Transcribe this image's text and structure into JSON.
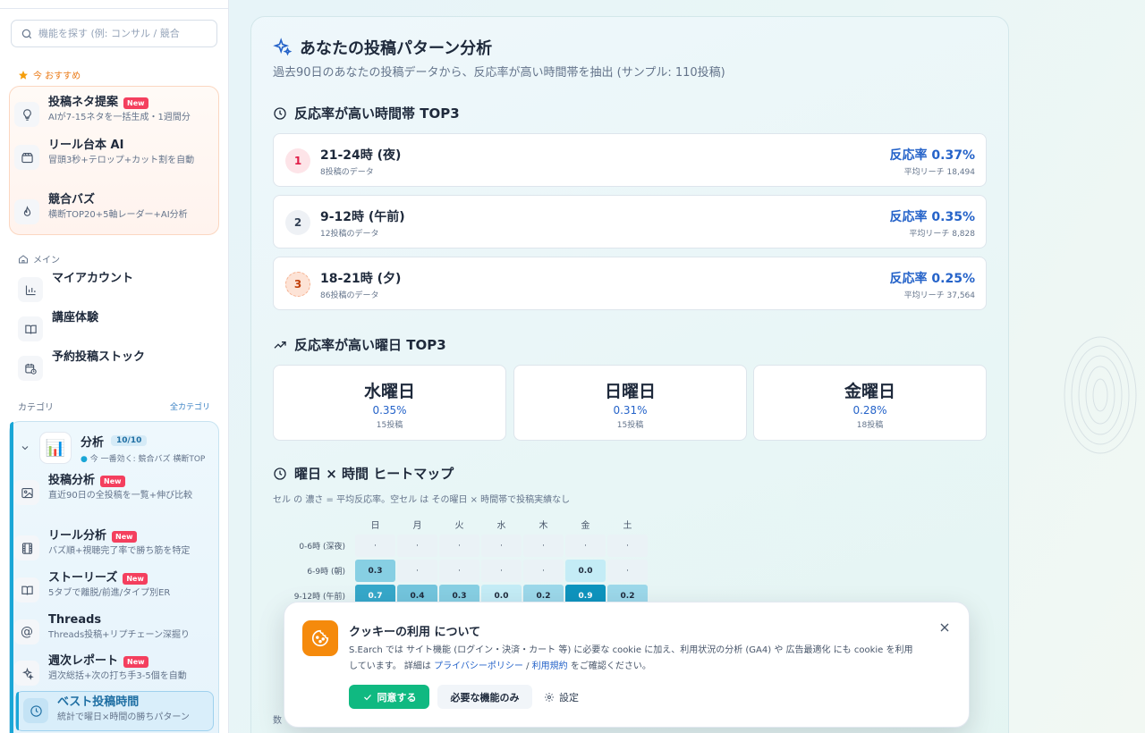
{
  "sidebar": {
    "search_placeholder": "機能を探す (例: コンサル / 競合",
    "recommended_label": "今 おすすめ",
    "recommended": [
      {
        "title": "投稿ネタ提案",
        "badge": "New",
        "sub": "AIが7-15ネタを一括生成・1週間分"
      },
      {
        "title": "リール台本 AI",
        "badge": "",
        "sub": "冒頭3秒+テロップ+カット割を自動"
      },
      {
        "title": "競合バズ",
        "badge": "",
        "sub": "横断TOP20+5軸レーダー+AI分析"
      }
    ],
    "main_label": "メイン",
    "main_items": [
      {
        "title": "マイアカウント"
      },
      {
        "title": "講座体験"
      },
      {
        "title": "予約投稿ストック"
      }
    ],
    "category_label": "カテゴリ",
    "all_categories": "全カテゴリ",
    "category": {
      "title": "分析",
      "count": "10/10",
      "sub": "今 一番効く: 競合バズ 横断TOP",
      "emoji": "📊",
      "items": [
        {
          "title": "投稿分析",
          "badge": "New",
          "sub": "直近90日の全投稿を一覧+伸び比較"
        },
        {
          "title": "リール分析",
          "badge": "New",
          "sub": "バズ順+視聴完了率で勝ち筋を特定"
        },
        {
          "title": "ストーリーズ",
          "badge": "New",
          "sub": "5タブで離脱/前進/タイプ別ER"
        },
        {
          "title": "Threads",
          "badge": "",
          "sub": "Threads投稿+リプチェーン深掘り"
        },
        {
          "title": "週次レポート",
          "badge": "New",
          "sub": "週次総括+次の打ち手3-5個を自動"
        },
        {
          "title": "ベスト投稿時間",
          "badge": "",
          "sub": "統計で曜日×時間の勝ちパターン"
        }
      ]
    }
  },
  "main": {
    "title": "あなたの投稿パターン分析",
    "subtitle": "過去90日のあなたの投稿データから、反応率が高い時間帯を抽出 (サンプル: 110投稿)",
    "time_section_title": "反応率が高い時間帯 TOP3",
    "time_top": [
      {
        "rank": "1",
        "time": "21-24時 (夜)",
        "count": "8投稿のデータ",
        "rate": "反応率 0.37%",
        "reach": "平均リーチ 18,494"
      },
      {
        "rank": "2",
        "time": "9-12時 (午前)",
        "count": "12投稿のデータ",
        "rate": "反応率 0.35%",
        "reach": "平均リーチ 8,828"
      },
      {
        "rank": "3",
        "time": "18-21時 (夕)",
        "count": "86投稿のデータ",
        "rate": "反応率 0.25%",
        "reach": "平均リーチ 37,564"
      }
    ],
    "day_section_title": "反応率が高い曜日 TOP3",
    "day_top": [
      {
        "day": "水曜日",
        "rate": "0.35%",
        "count": "15投稿"
      },
      {
        "day": "日曜日",
        "rate": "0.31%",
        "count": "15投稿"
      },
      {
        "day": "金曜日",
        "rate": "0.28%",
        "count": "18投稿"
      }
    ],
    "heatmap_title": "曜日 × 時間 ヒートマップ",
    "heatmap_note": "セル の 濃さ = 平均反応率。空セル は その曜日 × 時間帯で投稿実績なし",
    "heatmap": {
      "days": [
        "日",
        "月",
        "火",
        "水",
        "木",
        "金",
        "土"
      ],
      "rows": [
        {
          "label": "0-6時 (深夜)",
          "values": [
            null,
            null,
            null,
            null,
            null,
            null,
            null
          ]
        },
        {
          "label": "6-9時 (朝)",
          "values": [
            0.3,
            null,
            null,
            null,
            null,
            0.0,
            null
          ]
        },
        {
          "label": "9-12時 (午前)",
          "values": [
            0.7,
            0.4,
            0.3,
            0.0,
            0.2,
            0.9,
            0.2
          ]
        }
      ],
      "empty_symbol": "·"
    },
    "footer_fragment": "数"
  },
  "cookie": {
    "title": "クッキーの利用 について",
    "text_before": "S.Earch では サイト機能 (ログイン・決済・カート 等) に必要な cookie に加え、利用状況の分析 (GA4) や 広告最適化 にも cookie を利用しています。 詳細は",
    "privacy_link": "プライバシーポリシー",
    "separator": "/",
    "terms_link": "利用規約",
    "text_after": "をご確認ください。",
    "agree": "同意する",
    "necessary": "必要な機能のみ",
    "settings": "設定"
  },
  "colors": {
    "accent": "#1aa6d6",
    "rate_blue": "#2563c9",
    "new_badge": "#f43f5e",
    "agree_green": "#10b981",
    "cookie_orange": "#f58a0c"
  }
}
